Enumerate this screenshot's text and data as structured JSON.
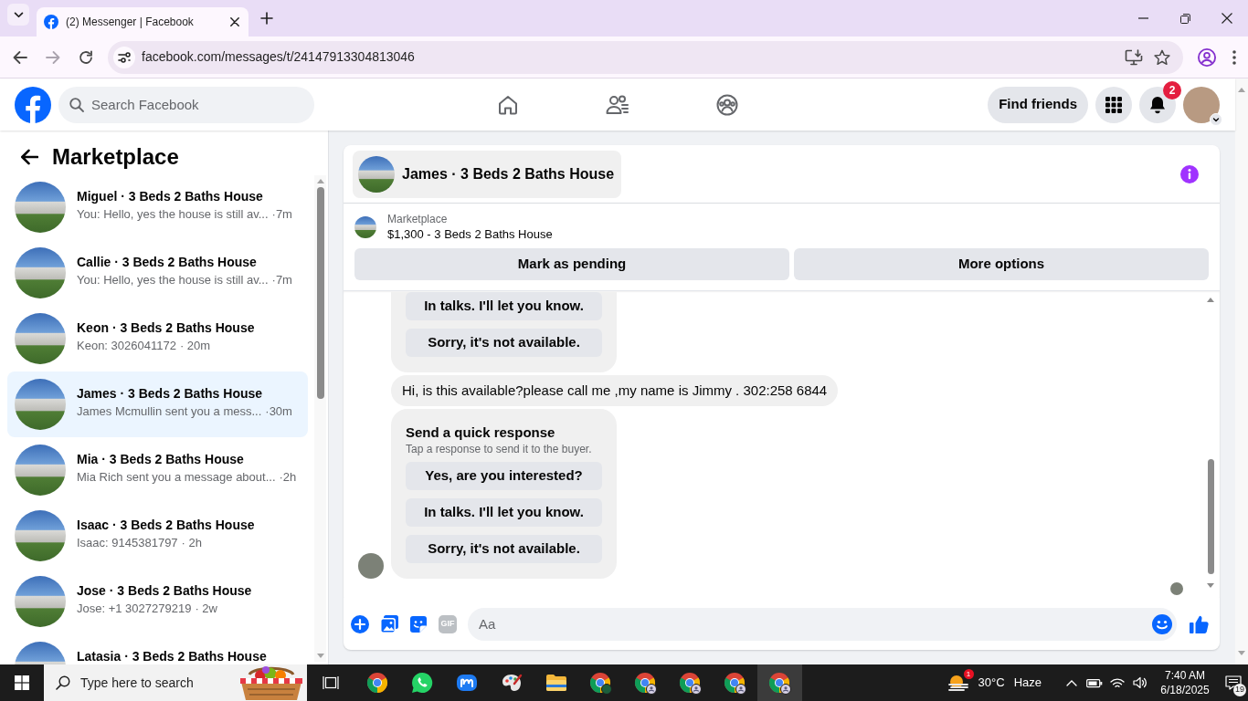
{
  "browser": {
    "tabs": [
      {
        "title": "(2) Messenger | Facebook",
        "selected": true
      }
    ],
    "url": "facebook.com/messages/t/24147913304813046"
  },
  "header": {
    "search": {
      "placeholder": "Search Facebook"
    },
    "nav": [
      {
        "kind": "home"
      },
      {
        "kind": "friends"
      },
      {
        "kind": "groups"
      }
    ],
    "find_friends": "Find friends",
    "notification_count": "2"
  },
  "sidebar": {
    "title": "Marketplace",
    "conversations": [
      {
        "title": "Miguel · 3 Beds 2 Baths House",
        "preview": "You: Hello, yes the house is still av...",
        "time": "·7m",
        "selected": false
      },
      {
        "title": "Callie · 3 Beds 2 Baths House",
        "preview": "You: Hello, yes the house is still av...",
        "time": "·7m",
        "selected": false
      },
      {
        "title": "Keon · 3 Beds 2 Baths House",
        "preview": "Keon: 3026041172",
        "time": "· 20m",
        "selected": false
      },
      {
        "title": "James · 3 Beds 2 Baths House",
        "preview": "James Mcmullin sent you a mess...",
        "time": "·30m",
        "selected": true
      },
      {
        "title": "Mia · 3 Beds 2 Baths House",
        "preview": "Mia Rich sent you a message about...",
        "time": "·2h",
        "selected": false
      },
      {
        "title": "Isaac · 3 Beds 2 Baths House",
        "preview": "Isaac: 9145381797",
        "time": "· 2h",
        "selected": false
      },
      {
        "title": "Jose · 3 Beds 2 Baths House",
        "preview": "Jose: +1 3027279219",
        "time": "· 2w",
        "selected": false
      },
      {
        "title": "Latasia · 3 Beds 2 Baths House",
        "selected": false
      }
    ]
  },
  "chat": {
    "title": "James · 3 Beds 2 Baths House",
    "listing": {
      "source": "Marketplace",
      "title": "$1,300 - 3 Beds 2 Baths House"
    },
    "actions": [
      "Mark as pending",
      "More options"
    ],
    "messages": [
      {
        "kind": "quick_responses",
        "responses": [
          "In talks. I'll let you know.",
          "Sorry, it's not available."
        ]
      },
      {
        "kind": "text",
        "text": "Hi, is this available?please call me ,my name is Jimmy . 302:258 6844"
      },
      {
        "kind": "quick_responses",
        "title": "Send a quick response",
        "hint": "Tap a response to send it to the buyer.",
        "responses": [
          "Yes, are you interested?",
          "In talks. I'll let you know.",
          "Sorry, it's not available."
        ]
      }
    ],
    "composer": {
      "gif": "GIF",
      "placeholder": "Aa"
    }
  },
  "taskbar": {
    "search": {
      "placeholder": "Type here to search"
    },
    "apps": [
      {
        "kind": "browser",
        "selected": false
      },
      {
        "kind": "chat",
        "selected": false
      },
      {
        "kind": "tile",
        "selected": false
      },
      {
        "kind": "palette",
        "selected": false
      },
      {
        "kind": "folder",
        "selected": false
      },
      {
        "kind": "browser_m",
        "selected": false
      },
      {
        "kind": "browser_profile",
        "selected": false
      },
      {
        "kind": "browser_profile",
        "selected": false
      },
      {
        "kind": "browser_profile",
        "selected": false
      },
      {
        "kind": "browser_profile",
        "selected": true
      }
    ],
    "weather": {
      "badge": "1",
      "temperature": "30°C",
      "condition": "Haze"
    },
    "clock": {
      "time": "7:40 AM",
      "date": "6/18/2025"
    },
    "notification_count": "19"
  }
}
